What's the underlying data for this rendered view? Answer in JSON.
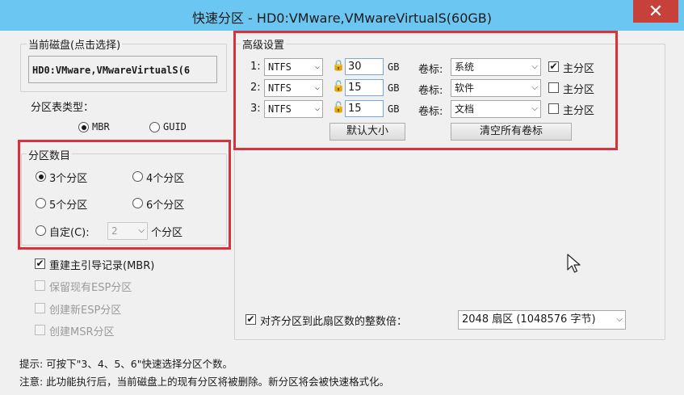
{
  "window": {
    "title": "快速分区 - HD0:VMware,VMwareVirtualS(60GB)",
    "close_glyph": "✕"
  },
  "disk": {
    "label": "当前磁盘(点击选择)",
    "value": "HD0:VMware,VMwareVirtualS(6"
  },
  "partition_table": {
    "label": "分区表类型：",
    "options": [
      "MBR",
      "GUID"
    ],
    "selected": "MBR"
  },
  "partition_count": {
    "label": "分区数目",
    "options": [
      "3个分区",
      "4个分区",
      "5个分区",
      "6个分区",
      "自定(C):"
    ],
    "selected": "3个分区",
    "custom_value": "2",
    "custom_suffix": "个分区"
  },
  "options": {
    "rebuild_mbr": {
      "label": "重建主引导记录(MBR)",
      "checked": true
    },
    "keep_esp": {
      "label": "保留现有ESP分区",
      "checked": false
    },
    "create_esp": {
      "label": "创建新ESP分区",
      "checked": false
    },
    "create_msr": {
      "label": "创建MSR分区",
      "checked": false
    }
  },
  "advanced": {
    "label": "高级设置",
    "rows": [
      {
        "index": "1:",
        "fs": "NTFS",
        "size": "30",
        "unit": "GB",
        "vol_label_text": "卷标:",
        "vol_label": "系统",
        "primary_label": "主分区",
        "primary": true,
        "locked": true
      },
      {
        "index": "2:",
        "fs": "NTFS",
        "size": "15",
        "unit": "GB",
        "vol_label_text": "卷标:",
        "vol_label": "软件",
        "primary_label": "主分区",
        "primary": false,
        "locked": false
      },
      {
        "index": "3:",
        "fs": "NTFS",
        "size": "15",
        "unit": "GB",
        "vol_label_text": "卷标:",
        "vol_label": "文档",
        "primary_label": "主分区",
        "primary": false,
        "locked": false
      }
    ],
    "default_size_button": "默认大小",
    "clear_labels_button": "清空所有卷标"
  },
  "align": {
    "label": "对齐分区到此扇区数的整数倍：",
    "checked": true,
    "value": "2048 扇区 (1048576 字节)"
  },
  "hints": {
    "tip": "提示: 可按下\"3、4、5、6\"快速选择分区个数。",
    "warning": "注意: 此功能执行后，当前磁盘上的现有分区将被删除。新分区将会被快速格式化。"
  },
  "colors": {
    "titlebar": "#6cc6f2",
    "close": "#c7403a",
    "highlight": "#d9323a"
  }
}
